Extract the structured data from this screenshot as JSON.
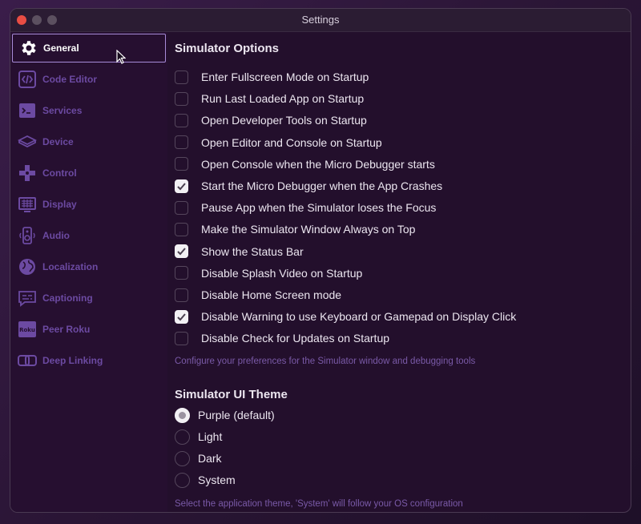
{
  "window": {
    "title": "Settings"
  },
  "sidebar": {
    "items": [
      {
        "label": "General",
        "icon": "gear-icon",
        "active": true
      },
      {
        "label": "Code Editor",
        "icon": "code-icon",
        "active": false
      },
      {
        "label": "Services",
        "icon": "terminal-icon",
        "active": false
      },
      {
        "label": "Device",
        "icon": "device-icon",
        "active": false
      },
      {
        "label": "Control",
        "icon": "dpad-icon",
        "active": false
      },
      {
        "label": "Display",
        "icon": "display-icon",
        "active": false
      },
      {
        "label": "Audio",
        "icon": "speaker-icon",
        "active": false
      },
      {
        "label": "Localization",
        "icon": "globe-icon",
        "active": false
      },
      {
        "label": "Captioning",
        "icon": "caption-icon",
        "active": false
      },
      {
        "label": "Peer Roku",
        "icon": "roku-icon",
        "active": false
      },
      {
        "label": "Deep Linking",
        "icon": "link-icon",
        "active": false
      }
    ],
    "roku_badge": "Roku"
  },
  "simulator_options": {
    "title": "Simulator Options",
    "options": [
      {
        "label": "Enter Fullscreen Mode on Startup",
        "checked": false
      },
      {
        "label": "Run Last Loaded App on Startup",
        "checked": false
      },
      {
        "label": "Open Developer Tools on Startup",
        "checked": false
      },
      {
        "label": "Open Editor and Console on Startup",
        "checked": false
      },
      {
        "label": "Open Console when the Micro Debugger starts",
        "checked": false
      },
      {
        "label": "Start the Micro Debugger when the App Crashes",
        "checked": true
      },
      {
        "label": "Pause App when the Simulator loses the Focus",
        "checked": false
      },
      {
        "label": "Make the Simulator Window Always on Top",
        "checked": false
      },
      {
        "label": "Show the Status Bar",
        "checked": true
      },
      {
        "label": "Disable Splash Video on Startup",
        "checked": false
      },
      {
        "label": "Disable Home Screen mode",
        "checked": false
      },
      {
        "label": "Disable Warning to use Keyboard or Gamepad on Display Click",
        "checked": true
      },
      {
        "label": "Disable Check for Updates on Startup",
        "checked": false
      }
    ],
    "hint": "Configure your preferences for the Simulator window and debugging tools"
  },
  "ui_theme": {
    "title": "Simulator UI Theme",
    "options": [
      {
        "label": "Purple (default)",
        "selected": true
      },
      {
        "label": "Light",
        "selected": false
      },
      {
        "label": "Dark",
        "selected": false
      },
      {
        "label": "System",
        "selected": false
      }
    ],
    "hint": "Select the application theme, 'System' will follow your OS configuration"
  },
  "colors": {
    "accent": "#6c4aa2",
    "background": "#230f2c",
    "active_border": "#a78bd8",
    "close_button": "#e94d44"
  }
}
